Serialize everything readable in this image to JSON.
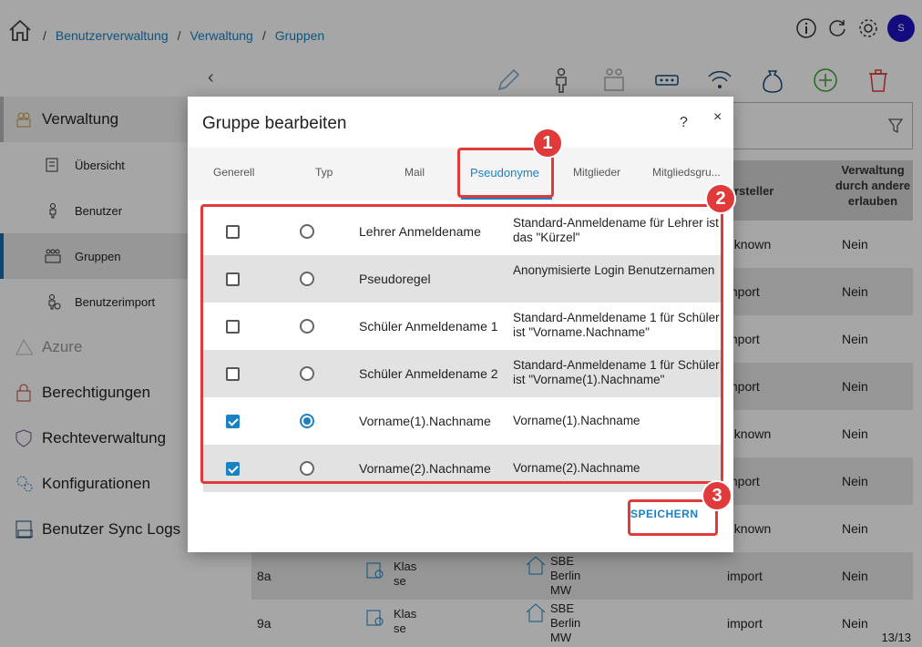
{
  "breadcrumb": [
    "Benutzerverwaltung",
    "Verwaltung",
    "Gruppen"
  ],
  "breadcrumb_sep": "/",
  "user": {
    "avatar_letter": "S"
  },
  "sidebar": {
    "sections": [
      {
        "label": "Verwaltung",
        "icon": "users-admin-icon"
      },
      {
        "label": "Azure",
        "icon": "azure-icon"
      },
      {
        "label": "Berechtigungen",
        "icon": "lock-icon"
      },
      {
        "label": "Rechteverwaltung",
        "icon": "shield-key-icon"
      },
      {
        "label": "Konfigurationen",
        "icon": "gears-icon"
      },
      {
        "label": "Benutzer Sync Logs",
        "icon": "log-icon"
      }
    ],
    "sub_items": [
      {
        "label": "Übersicht",
        "icon": "overview-icon"
      },
      {
        "label": "Benutzer",
        "icon": "user-icon"
      },
      {
        "label": "Gruppen",
        "icon": "group-icon"
      },
      {
        "label": "Benutzerimport",
        "icon": "user-import-icon"
      }
    ]
  },
  "grid": {
    "headers": {
      "creator": "rsteller",
      "allow_admin": "Verwaltung durch andere erlauben"
    },
    "rows": [
      {
        "a": "",
        "creator": "nknown",
        "allow": "Nein"
      },
      {
        "a": "",
        "creator": "mport",
        "allow": "Nein"
      },
      {
        "a": "",
        "creator": "mport",
        "allow": "Nein"
      },
      {
        "a": "",
        "creator": "mport",
        "allow": "Nein"
      },
      {
        "a": "",
        "creator": "nknown",
        "allow": "Nein"
      },
      {
        "a": "",
        "creator": "mport",
        "allow": "Nein"
      },
      {
        "a": "",
        "creator": "nknown",
        "allow": "Nein"
      },
      {
        "a": "8a",
        "type": "Klas se",
        "school": "SBE Berlin MW",
        "creator": "import",
        "allow": "Nein"
      },
      {
        "a": "9a",
        "type": "Klas se",
        "school": "SBE Berlin MW",
        "creator": "import",
        "allow": "Nein"
      }
    ],
    "pager": "13/13"
  },
  "modal": {
    "title": "Gruppe bearbeiten",
    "help": "?",
    "close": "×",
    "tabs": [
      "Generell",
      "Typ",
      "Mail",
      "Pseudonyme",
      "Mitglieder",
      "Mitgliedsgru..."
    ],
    "active_tab": 3,
    "rows": [
      {
        "checked": false,
        "selected": false,
        "name": "Lehrer Anmeldename",
        "desc": "Standard-Anmeldename für Lehrer ist das \"Kürzel\""
      },
      {
        "checked": false,
        "selected": false,
        "name": "Pseudoregel",
        "desc": "Anonymisierte Login Benutzernamen"
      },
      {
        "checked": false,
        "selected": false,
        "name": "Schüler Anmeldename 1",
        "desc": "Standard-Anmeldename 1 für Schüler ist \"Vorname.Nachname\""
      },
      {
        "checked": false,
        "selected": false,
        "name": "Schüler Anmeldename 2",
        "desc": "Standard-Anmeldename 1 für Schüler ist \"Vorname(1).Nachname\""
      },
      {
        "checked": true,
        "selected": true,
        "name": "Vorname(1).Nachname",
        "desc": "Vorname(1).Nachname"
      },
      {
        "checked": true,
        "selected": false,
        "name": "Vorname(2).Nachname",
        "desc": "Vorname(2).Nachname"
      }
    ],
    "save_label": "SPEICHERN"
  },
  "annotations": [
    "1",
    "2",
    "3"
  ],
  "colors": {
    "accent": "#1a82c4",
    "highlight": "#e03a3a",
    "avatar": "#1f12c4"
  }
}
